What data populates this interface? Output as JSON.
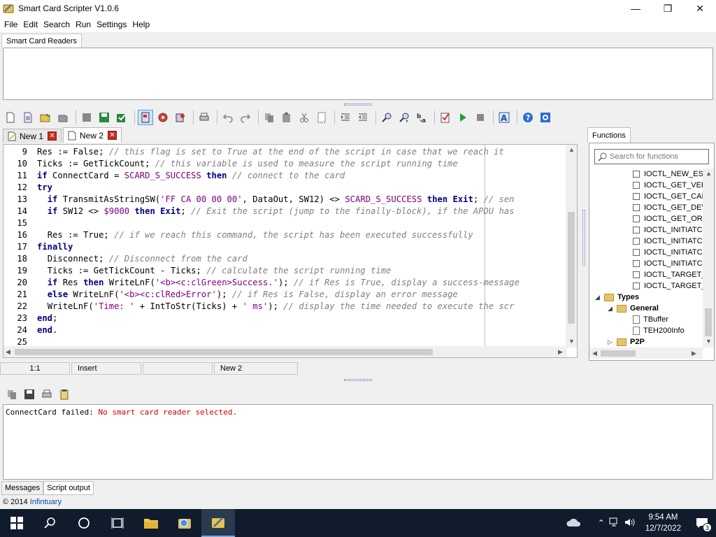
{
  "window": {
    "title": "Smart Card Scripter V1.0.6"
  },
  "menu": [
    "File",
    "Edit",
    "Search",
    "Run",
    "Settings",
    "Help"
  ],
  "readers": {
    "tab_label": "Smart Card Readers"
  },
  "editor_tabs": [
    {
      "label": "New 1",
      "selected": false
    },
    {
      "label": "New 2",
      "selected": true
    }
  ],
  "code_lines": [
    {
      "n": "9",
      "code": "Res := False;",
      "comment": "// this flag is set to True at the end of the script in case that we reach it"
    },
    {
      "n": "10",
      "code": "Ticks := GetTickCount;",
      "comment": "// this variable is used to measure the script running time"
    },
    {
      "n": "11",
      "code": "if ConnectCard = SCARD_S_SUCCESS then",
      "comment": "// connect to the card"
    },
    {
      "n": "12",
      "code": "try",
      "comment": ""
    },
    {
      "n": "13",
      "code": "  if TransmitAsStringSW('FF CA 00 00 00', DataOut, SW12) <> SCARD_S_SUCCESS then Exit;",
      "comment": "// sen"
    },
    {
      "n": "14",
      "code": "  if SW12 <> $9000 then Exit;",
      "comment": "// Exit the script (jump to the finally-block), if the APDU has"
    },
    {
      "n": "15",
      "code": "",
      "comment": ""
    },
    {
      "n": "16",
      "code": "  Res := True;",
      "comment": "// if we reach this command, the script has been executed successfully"
    },
    {
      "n": "17",
      "code": "finally",
      "comment": ""
    },
    {
      "n": "18",
      "code": "  Disconnect;",
      "comment": "// Disconnect from the card"
    },
    {
      "n": "19",
      "code": "  Ticks := GetTickCount - Ticks;",
      "comment": "// calculate the script running time"
    },
    {
      "n": "20",
      "code": "  if Res then WriteLnF('<b><c:clGreen>Success.');",
      "comment": "// if Res is True, display a success-message"
    },
    {
      "n": "21",
      "code": "  else WriteLnF('<b><c:clRed>Error');",
      "comment": "// if Res is False, display an error message"
    },
    {
      "n": "22",
      "code": "  WriteLnF('Time: ' + IntToStr(Ticks) + ' ms');",
      "comment": "// display the time needed to execute the scr"
    },
    {
      "n": "23",
      "code": "end;",
      "comment": ""
    },
    {
      "n": "24",
      "code": "end.",
      "comment": ""
    },
    {
      "n": "25",
      "code": "",
      "comment": ""
    }
  ],
  "status": {
    "position": "1:1",
    "mode": "Insert",
    "empty": "",
    "file": "New 2"
  },
  "functions": {
    "tab_label": "Functions",
    "search_placeholder": "Search for functions",
    "items": [
      "IOCTL_NEW_ES",
      "IOCTL_GET_VEF",
      "IOCTL_GET_CAF",
      "IOCTL_GET_DEV",
      "IOCTL_GET_OR_",
      "IOCTL_INITIATC",
      "IOCTL_INITIATC",
      "IOCTL_INITIATC",
      "IOCTL_INITIATC",
      "IOCTL_TARGET_",
      "IOCTL_TARGET_"
    ],
    "types_label": "Types",
    "general_label": "General",
    "type_items": [
      "TBuffer",
      "TEH200Info"
    ],
    "p2p_label": "P2P"
  },
  "messages": {
    "prefix": "ConnectCard failed: ",
    "error": "No smart card reader selected.",
    "tabs": [
      "Messages",
      "Script output"
    ]
  },
  "footer": {
    "copyright": "© 2014 ",
    "company": "Infintuary"
  },
  "taskbar": {
    "time": "9:54 AM",
    "date": "12/7/2022",
    "notification_count": "3"
  }
}
